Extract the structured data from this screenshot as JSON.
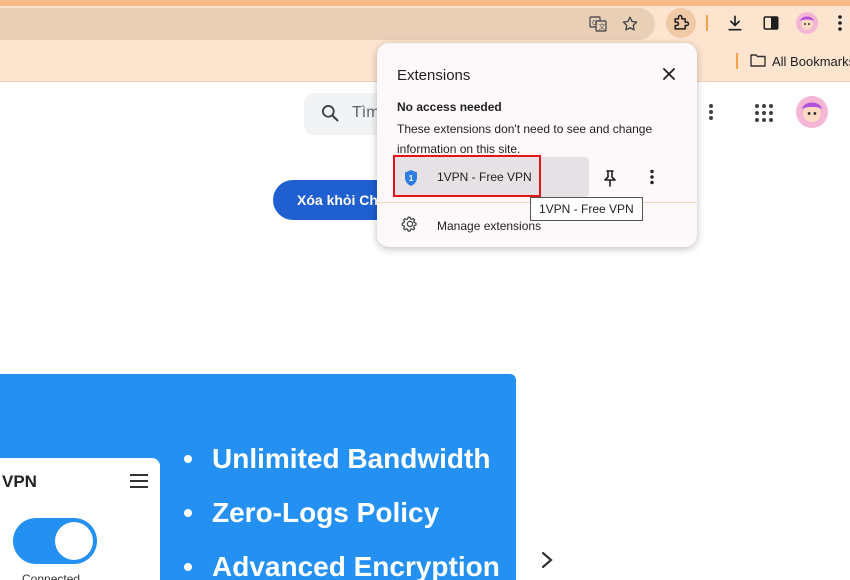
{
  "toolbar": {
    "icons": [
      "translate-icon",
      "bookmark-star-icon",
      "extensions-puzzle-icon",
      "download-icon",
      "side-panel-icon",
      "profile-avatar",
      "browser-menu-icon"
    ]
  },
  "bookmarks_bar": {
    "all_bookmarks_label": "All Bookmarks"
  },
  "page": {
    "search_text": "Tìm",
    "remove_button_label": "Xóa khỏi Ch"
  },
  "promo": {
    "card_title": "VPN",
    "connected_label": "Connected",
    "bullets": [
      "Unlimited Bandwidth",
      "Zero-Logs Policy",
      "Advanced Encryption"
    ],
    "accent_color": "#2390f2"
  },
  "extensions_popup": {
    "title": "Extensions",
    "section_title": "No access needed",
    "description": "These extensions don't need to see and change information on this site.",
    "extension_name": "1VPN - Free VPN",
    "manage_label": "Manage extensions",
    "tooltip": "1VPN - Free VPN",
    "highlight_color": "#e3141b"
  }
}
